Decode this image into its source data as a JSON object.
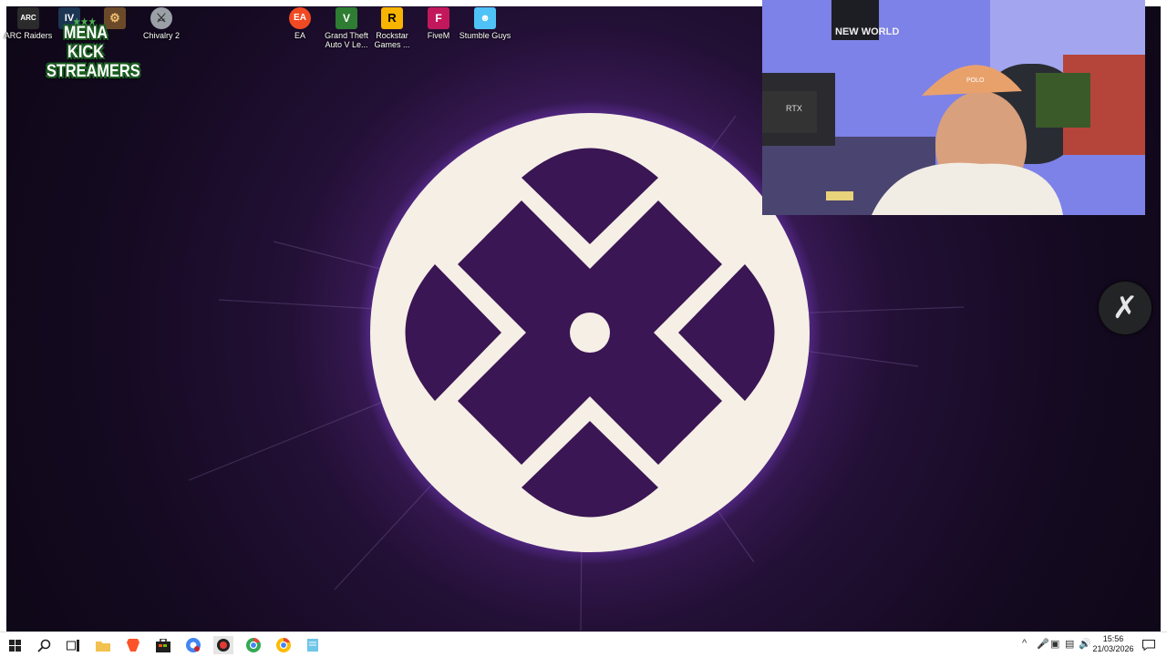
{
  "desktop_icons": [
    {
      "name": "arc-raiders",
      "label": "ARC Raiders",
      "icon": "arc-raiders-icon"
    },
    {
      "name": "gta-iv",
      "label": "",
      "icon": "gta-iv-icon"
    },
    {
      "name": "unknown-game",
      "label": "",
      "icon": "game-icon"
    },
    {
      "name": "chivalry",
      "label": "Chivalry 2",
      "icon": "chivalry-icon"
    },
    {
      "name": "ea",
      "label": "EA",
      "icon": "ea-icon"
    },
    {
      "name": "gta-v",
      "label": "Grand Theft Auto V Le...",
      "icon": "gta-v-icon"
    },
    {
      "name": "rockstar",
      "label": "Rockstar Games ...",
      "icon": "rockstar-icon"
    },
    {
      "name": "fivem",
      "label": "FiveM",
      "icon": "fivem-icon"
    },
    {
      "name": "stumble",
      "label": "Stumble Guys",
      "icon": "stumble-guys-icon"
    }
  ],
  "overlay": {
    "badge_line1": "MENA KICK",
    "badge_line2": "STREAMERS",
    "stars": "★★★"
  },
  "webcam": {
    "poster_text": "NEW WORLD",
    "hat_text": "POLO",
    "box_text": "RTX"
  },
  "floating_button": {
    "glyph": "✗"
  },
  "taskbar": {
    "items": [
      "start",
      "search",
      "task-view",
      "file-explorer",
      "brave",
      "store",
      "chrome-profile-1",
      "app-red",
      "chrome",
      "chrome-2",
      "notepad"
    ],
    "clock_time": "15:56",
    "clock_date": "21/03/2026"
  },
  "colors": {
    "wallpaper_dark": "#150a22",
    "wallpaper_purple": "#5b2a86",
    "emblem_cream": "#f6efe6",
    "emblem_purple": "#3a1654"
  }
}
